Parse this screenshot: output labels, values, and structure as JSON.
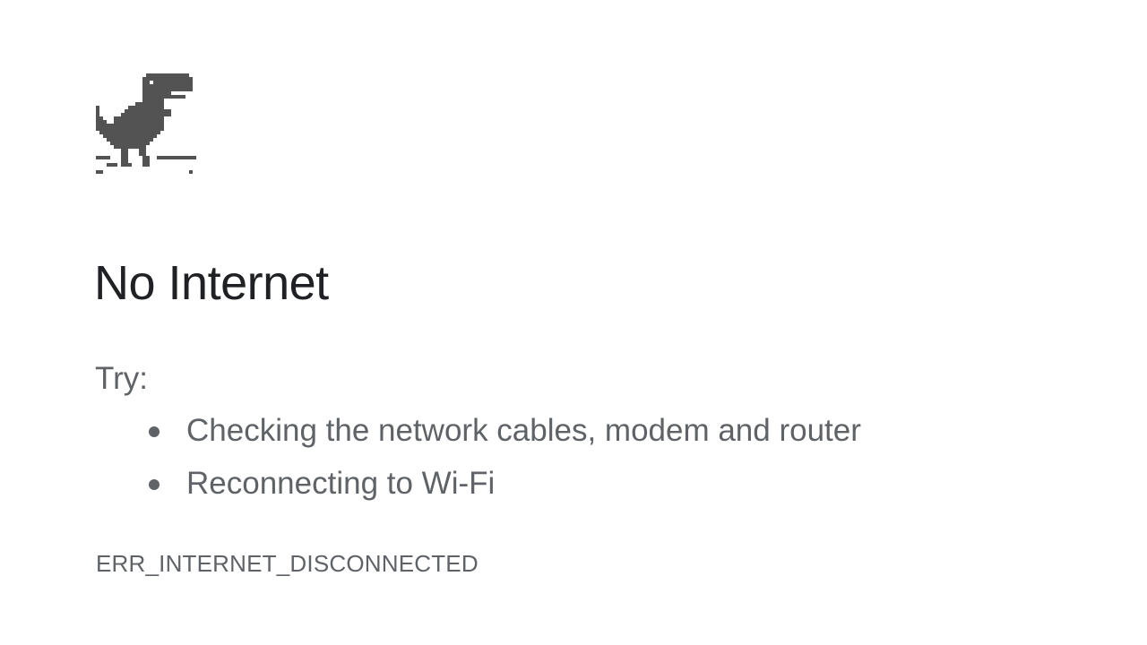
{
  "error_page": {
    "title": "No Internet",
    "try_label": "Try:",
    "suggestions": [
      "Checking the network cables, modem and router",
      "Reconnecting to Wi-Fi"
    ],
    "error_code": "ERR_INTERNET_DISCONNECTED"
  },
  "icons": {
    "dino": "dinosaur-icon"
  },
  "colors": {
    "dino": "#535353",
    "title": "#202124",
    "body_text": "#5f6368",
    "background": "#ffffff"
  }
}
